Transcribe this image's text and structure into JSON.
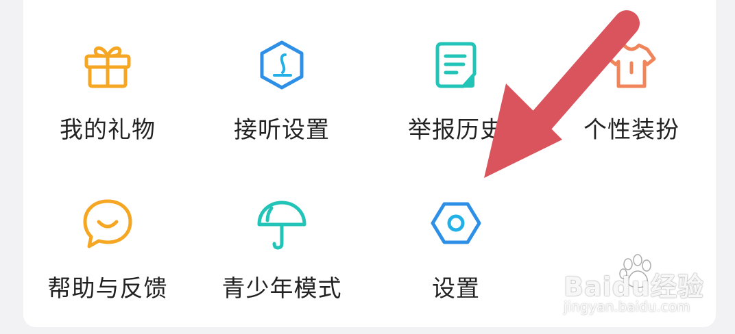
{
  "menu": {
    "items": [
      {
        "label": "我的礼物",
        "icon": "gift-icon",
        "color": "#f5a623"
      },
      {
        "label": "接听设置",
        "icon": "phone-hexagon-icon",
        "color": "#2d8fe6"
      },
      {
        "label": "举报历史",
        "icon": "document-icon",
        "color": "#22c4b8"
      },
      {
        "label": "个性装扮",
        "icon": "shirt-icon",
        "color": "#f0845a"
      },
      {
        "label": "帮助与反馈",
        "icon": "chat-smile-icon",
        "color": "#f5a623"
      },
      {
        "label": "青少年模式",
        "icon": "umbrella-icon",
        "color": "#22c4b8"
      },
      {
        "label": "设置",
        "icon": "settings-hex-icon",
        "color": "#2d8fe6"
      }
    ]
  },
  "annotation": {
    "arrow_color": "#d9545c"
  },
  "watermark": {
    "brand": "Baidu经验",
    "site": "jingyan.baidu.com"
  }
}
